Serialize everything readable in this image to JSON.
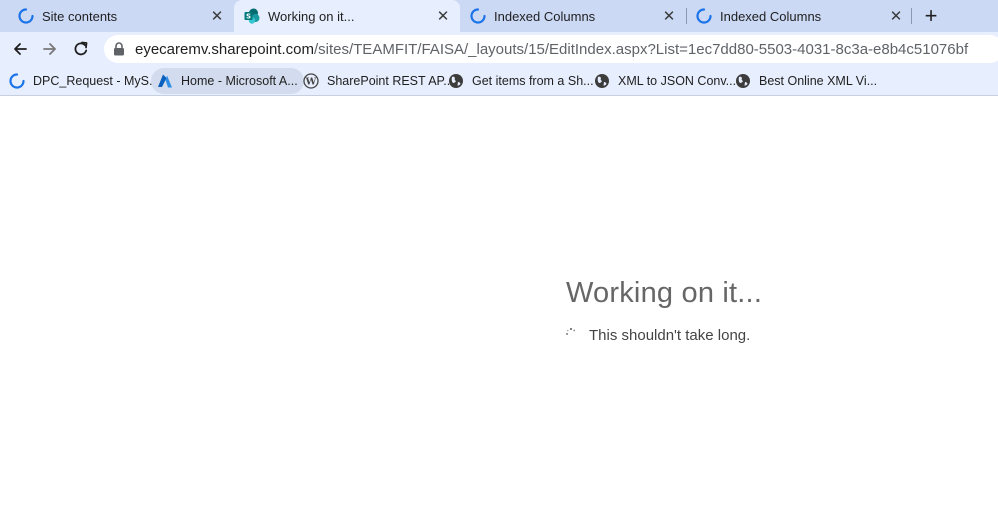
{
  "tabs": [
    {
      "title": "Site contents",
      "icon": "loading-spinner-icon",
      "active": false
    },
    {
      "title": "Working on it...",
      "icon": "sharepoint-icon",
      "active": true
    },
    {
      "title": "Indexed Columns",
      "icon": "loading-spinner-icon",
      "active": false
    },
    {
      "title": "Indexed Columns",
      "icon": "loading-spinner-icon",
      "active": false
    }
  ],
  "tab_close_glyph": "✕",
  "new_tab_glyph": "+",
  "address_bar": {
    "host": "eyecaremv.sharepoint.com",
    "path": "/sites/TEAMFIT/FAISA/_layouts/15/EditIndex.aspx?List=1ec7dd80-5503-4031-8c3a-e8b4c51076bf"
  },
  "bookmarks": [
    {
      "label": "DPC_Request - MyS...",
      "icon": "loading-spinner-icon"
    },
    {
      "label": "Home - Microsoft A...",
      "icon": "azure-icon"
    },
    {
      "label": "SharePoint REST AP...",
      "icon": "wordpress-icon"
    },
    {
      "label": "Get items from a Sh...",
      "icon": "globe-icon"
    },
    {
      "label": "XML to JSON Conv...",
      "icon": "globe-icon"
    },
    {
      "label": "Best Online XML Vi...",
      "icon": "globe-icon"
    }
  ],
  "page": {
    "title": "Working on it...",
    "subtitle": "This shouldn't take long."
  },
  "colors": {
    "tabstrip": "#cbd9f5",
    "toolbar": "#e7eefd",
    "spinner_blue": "#1a73e8",
    "sharepoint_teal": "#03787c"
  }
}
